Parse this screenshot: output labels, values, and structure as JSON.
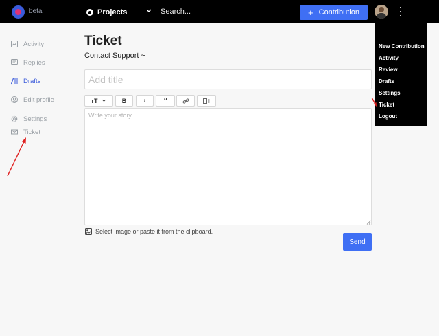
{
  "header": {
    "brand_tag": "beta",
    "projects_label": "Projects",
    "search_placeholder": "Search...",
    "contribution_label": "Contribution"
  },
  "menu": {
    "items": [
      {
        "label": "New Contribution"
      },
      {
        "label": "Activity"
      },
      {
        "label": "Review"
      },
      {
        "label": "Drafts"
      },
      {
        "label": "Settings"
      },
      {
        "label": "Ticket"
      },
      {
        "label": "Logout"
      }
    ]
  },
  "sidebar": {
    "items": [
      {
        "label": "Activity",
        "icon": "chart-icon"
      },
      {
        "label": "Replies",
        "icon": "chat-icon"
      },
      {
        "label": "Drafts",
        "icon": "list-edit-icon",
        "active": true
      },
      {
        "label": "Edit profile",
        "icon": "user-circle-icon"
      },
      {
        "label": "Settings",
        "icon": "gear-icon"
      },
      {
        "label": "Ticket",
        "icon": "mail-icon"
      }
    ]
  },
  "main": {
    "title": "Ticket",
    "subtitle": "Contact Support ~",
    "title_placeholder": "Add title",
    "editor_placeholder": "Write your story...",
    "image_note": "Select image or paste it from the clipboard.",
    "send_label": "Send"
  },
  "toolbar": {
    "text_size_label": "ᴛT",
    "bold_label": "B",
    "italic_label": "i",
    "quote_label": "“",
    "buttons": [
      "text-size-button",
      "bold-button",
      "italic-button",
      "quote-button",
      "link-button",
      "embed-button"
    ]
  },
  "colors": {
    "accent": "#3f6ff4",
    "header_bg": "#000000",
    "active_nav": "#3b5bdb",
    "annotation_arrow": "#e02020"
  }
}
